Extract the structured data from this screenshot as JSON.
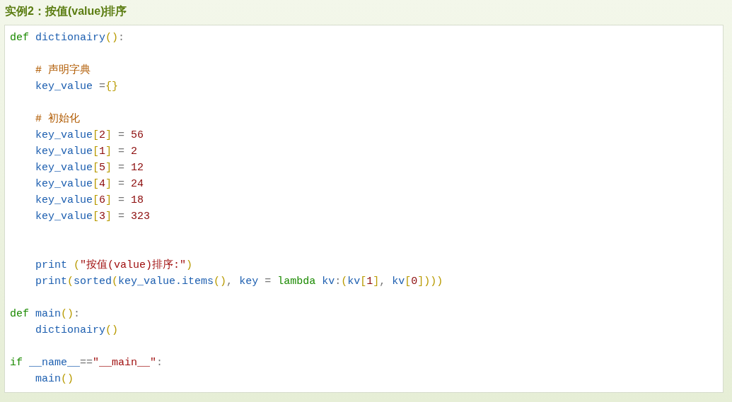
{
  "title": "实例2：按值(value)排序",
  "code_lines": [
    {
      "kind": "code",
      "tokens": [
        {
          "text": "def",
          "kind": "keyword"
        },
        {
          "text": " dictionairy",
          "kind": "name"
        },
        {
          "text": "()",
          "kind": "bracket"
        },
        {
          "text": ":",
          "kind": "op"
        }
      ]
    },
    {
      "kind": "blank"
    },
    {
      "kind": "code",
      "tokens": [
        {
          "text": "    # 声明字典",
          "kind": "comment"
        }
      ]
    },
    {
      "kind": "code",
      "tokens": [
        {
          "text": "    key_value ",
          "kind": "name"
        },
        {
          "text": "=",
          "kind": "op"
        },
        {
          "text": "{}",
          "kind": "bracket"
        }
      ]
    },
    {
      "kind": "blank"
    },
    {
      "kind": "code",
      "tokens": [
        {
          "text": "    # 初始化",
          "kind": "comment"
        }
      ]
    },
    {
      "kind": "code",
      "tokens": [
        {
          "text": "    key_value",
          "kind": "name"
        },
        {
          "text": "[",
          "kind": "bracket"
        },
        {
          "text": "2",
          "kind": "number"
        },
        {
          "text": "]",
          "kind": "bracket"
        },
        {
          "text": " = ",
          "kind": "op"
        },
        {
          "text": "56",
          "kind": "number"
        }
      ]
    },
    {
      "kind": "code",
      "tokens": [
        {
          "text": "    key_value",
          "kind": "name"
        },
        {
          "text": "[",
          "kind": "bracket"
        },
        {
          "text": "1",
          "kind": "number"
        },
        {
          "text": "]",
          "kind": "bracket"
        },
        {
          "text": " = ",
          "kind": "op"
        },
        {
          "text": "2",
          "kind": "number"
        }
      ]
    },
    {
      "kind": "code",
      "tokens": [
        {
          "text": "    key_value",
          "kind": "name"
        },
        {
          "text": "[",
          "kind": "bracket"
        },
        {
          "text": "5",
          "kind": "number"
        },
        {
          "text": "]",
          "kind": "bracket"
        },
        {
          "text": " = ",
          "kind": "op"
        },
        {
          "text": "12",
          "kind": "number"
        }
      ]
    },
    {
      "kind": "code",
      "tokens": [
        {
          "text": "    key_value",
          "kind": "name"
        },
        {
          "text": "[",
          "kind": "bracket"
        },
        {
          "text": "4",
          "kind": "number"
        },
        {
          "text": "]",
          "kind": "bracket"
        },
        {
          "text": " = ",
          "kind": "op"
        },
        {
          "text": "24",
          "kind": "number"
        }
      ]
    },
    {
      "kind": "code",
      "tokens": [
        {
          "text": "    key_value",
          "kind": "name"
        },
        {
          "text": "[",
          "kind": "bracket"
        },
        {
          "text": "6",
          "kind": "number"
        },
        {
          "text": "]",
          "kind": "bracket"
        },
        {
          "text": " = ",
          "kind": "op"
        },
        {
          "text": "18",
          "kind": "number"
        }
      ]
    },
    {
      "kind": "code",
      "tokens": [
        {
          "text": "    key_value",
          "kind": "name"
        },
        {
          "text": "[",
          "kind": "bracket"
        },
        {
          "text": "3",
          "kind": "number"
        },
        {
          "text": "]",
          "kind": "bracket"
        },
        {
          "text": " = ",
          "kind": "op"
        },
        {
          "text": "323",
          "kind": "number"
        }
      ]
    },
    {
      "kind": "blank"
    },
    {
      "kind": "blank"
    },
    {
      "kind": "code",
      "tokens": [
        {
          "text": "    print ",
          "kind": "name"
        },
        {
          "text": "(",
          "kind": "bracket"
        },
        {
          "text": "\"按值(value)排序:\"",
          "kind": "string"
        },
        {
          "text": ")",
          "kind": "bracket"
        }
      ]
    },
    {
      "kind": "code",
      "tokens": [
        {
          "text": "    print",
          "kind": "name"
        },
        {
          "text": "(",
          "kind": "bracket"
        },
        {
          "text": "sorted",
          "kind": "name"
        },
        {
          "text": "(",
          "kind": "bracket"
        },
        {
          "text": "key_value.items",
          "kind": "name"
        },
        {
          "text": "()",
          "kind": "bracket"
        },
        {
          "text": ", ",
          "kind": "op"
        },
        {
          "text": "key ",
          "kind": "name"
        },
        {
          "text": "= ",
          "kind": "op"
        },
        {
          "text": "lambda",
          "kind": "keyword"
        },
        {
          "text": " kv",
          "kind": "name"
        },
        {
          "text": ":",
          "kind": "op"
        },
        {
          "text": "(",
          "kind": "bracket"
        },
        {
          "text": "kv",
          "kind": "name"
        },
        {
          "text": "[",
          "kind": "bracket"
        },
        {
          "text": "1",
          "kind": "number"
        },
        {
          "text": "]",
          "kind": "bracket"
        },
        {
          "text": ", ",
          "kind": "op"
        },
        {
          "text": "kv",
          "kind": "name"
        },
        {
          "text": "[",
          "kind": "bracket"
        },
        {
          "text": "0",
          "kind": "number"
        },
        {
          "text": "])))",
          "kind": "bracket"
        }
      ]
    },
    {
      "kind": "blank"
    },
    {
      "kind": "code",
      "tokens": [
        {
          "text": "def",
          "kind": "keyword"
        },
        {
          "text": " main",
          "kind": "name"
        },
        {
          "text": "()",
          "kind": "bracket"
        },
        {
          "text": ":",
          "kind": "op"
        }
      ]
    },
    {
      "kind": "code",
      "tokens": [
        {
          "text": "    dictionairy",
          "kind": "name"
        },
        {
          "text": "()",
          "kind": "bracket"
        }
      ]
    },
    {
      "kind": "blank"
    },
    {
      "kind": "code",
      "tokens": [
        {
          "text": "if",
          "kind": "keyword"
        },
        {
          "text": " __name__",
          "kind": "name"
        },
        {
          "text": "==",
          "kind": "op"
        },
        {
          "text": "\"__main__\"",
          "kind": "string"
        },
        {
          "text": ":",
          "kind": "op"
        }
      ]
    },
    {
      "kind": "code",
      "tokens": [
        {
          "text": "    main",
          "kind": "name"
        },
        {
          "text": "()",
          "kind": "bracket"
        }
      ]
    }
  ]
}
